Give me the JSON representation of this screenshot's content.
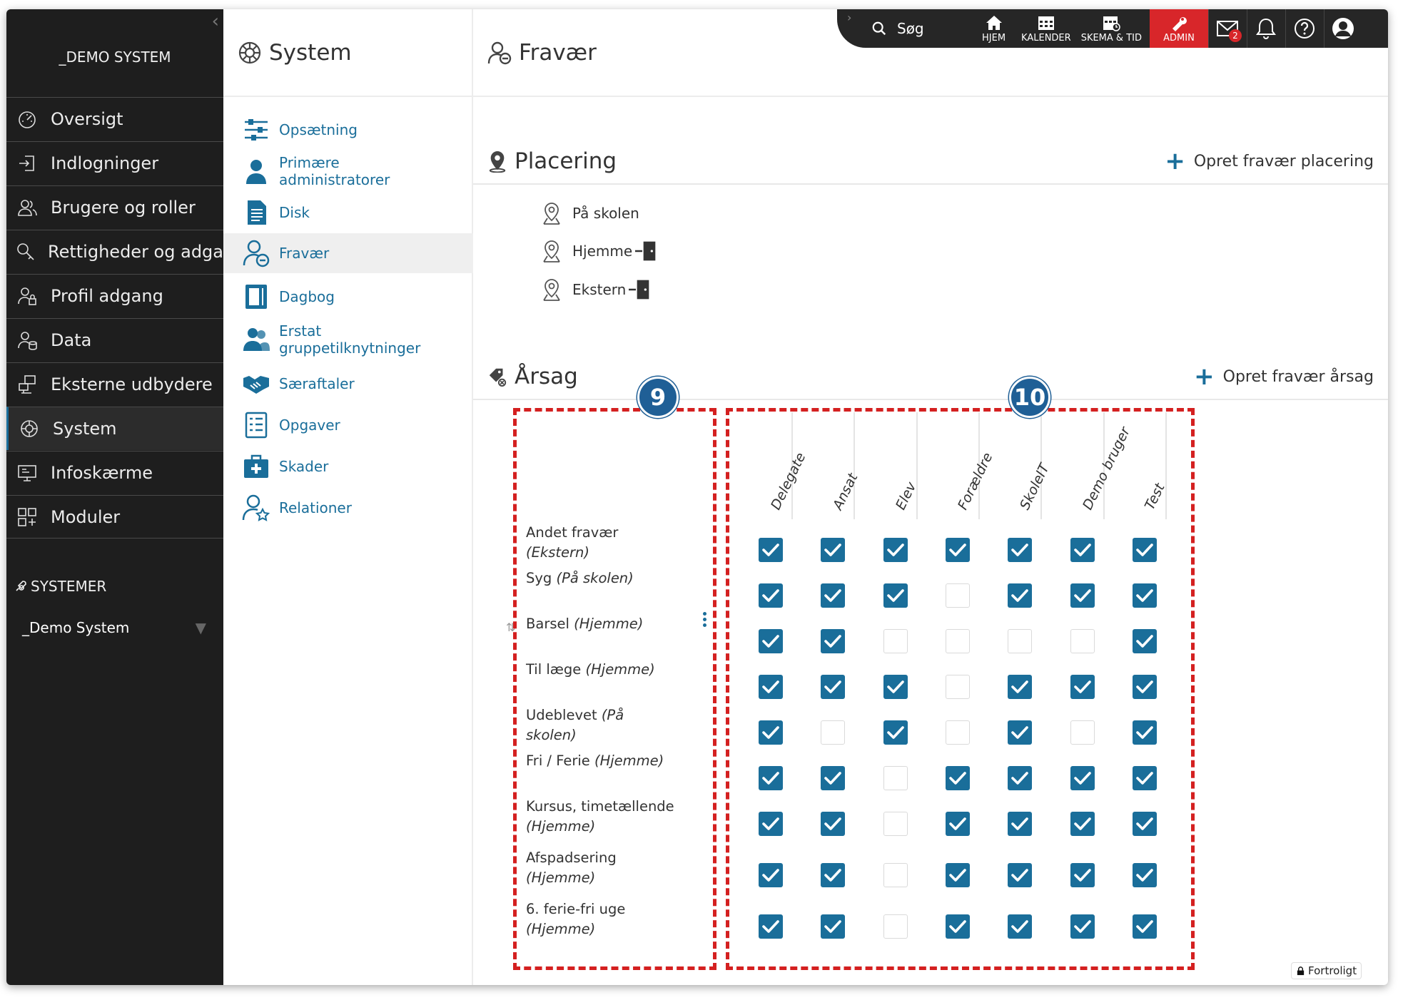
{
  "sidebar": {
    "brand": "_DEMO SYSTEM",
    "items": [
      {
        "label": "Oversigt",
        "icon": "gauge-icon"
      },
      {
        "label": "Indlogninger",
        "icon": "login-icon"
      },
      {
        "label": "Brugere og roller",
        "icon": "users-icon"
      },
      {
        "label": "Rettigheder og adgang",
        "icon": "key-search-icon"
      },
      {
        "label": "Profil adgang",
        "icon": "user-lock-icon"
      },
      {
        "label": "Data",
        "icon": "user-data-icon"
      },
      {
        "label": "Eksterne udbydere",
        "icon": "external-providers-icon"
      },
      {
        "label": "System",
        "icon": "globe-cog-icon"
      },
      {
        "label": "Infoskærme",
        "icon": "monitor-icon"
      },
      {
        "label": "Moduler",
        "icon": "modules-icon"
      }
    ],
    "systemer_label": "SYSTEMER",
    "system_select": "_Demo System"
  },
  "sysmenu": {
    "title": "System",
    "items": [
      {
        "label": "Opsætning"
      },
      {
        "label": "Primære administratorer"
      },
      {
        "label": "Disk"
      },
      {
        "label": "Fravær"
      },
      {
        "label": "Dagbog"
      },
      {
        "label": "Erstat gruppetilknytninger"
      },
      {
        "label": "Særaftaler"
      },
      {
        "label": "Opgaver"
      },
      {
        "label": "Skader"
      },
      {
        "label": "Relationer"
      }
    ]
  },
  "topbar": {
    "search": "Søg",
    "buttons": [
      {
        "label": "HJEM"
      },
      {
        "label": "KALENDER"
      },
      {
        "label": "SKEMA & TID"
      },
      {
        "label": "ADMIN"
      }
    ],
    "mail_badge": "2"
  },
  "main": {
    "title": "Fravær",
    "placering": {
      "title": "Placering",
      "action": "Opret fravær placering",
      "items": [
        "På skolen",
        "Hjemme",
        "Ekstern"
      ]
    },
    "arsag": {
      "title": "Årsag",
      "action": "Opret fravær årsag",
      "columns": [
        "Delegate",
        "Ansat",
        "Elev",
        "Forældre",
        "SkoleIT",
        "Demo bruger",
        "Test"
      ],
      "rows": [
        {
          "name": "Andet fravær",
          "place": "(Ekstern)",
          "checks": [
            1,
            1,
            1,
            1,
            1,
            1,
            1
          ]
        },
        {
          "name": "Syg",
          "place": "(På skolen)",
          "checks": [
            1,
            1,
            1,
            0,
            1,
            1,
            1
          ]
        },
        {
          "name": "Barsel",
          "place": "(Hjemme)",
          "checks": [
            1,
            1,
            0,
            0,
            0,
            0,
            1
          ]
        },
        {
          "name": "Til læge",
          "place": "(Hjemme)",
          "checks": [
            1,
            1,
            1,
            0,
            1,
            1,
            1
          ]
        },
        {
          "name": "Udeblevet",
          "place": "(På skolen)",
          "checks": [
            1,
            0,
            1,
            0,
            1,
            0,
            1
          ]
        },
        {
          "name": "Fri / Ferie",
          "place": "(Hjemme)",
          "checks": [
            1,
            1,
            0,
            1,
            1,
            1,
            1
          ]
        },
        {
          "name": "Kursus, timetællende",
          "place": "(Hjemme)",
          "checks": [
            1,
            1,
            0,
            1,
            1,
            1,
            1
          ]
        },
        {
          "name": "Afspadsering",
          "place": "(Hjemme)",
          "checks": [
            1,
            1,
            0,
            1,
            1,
            1,
            1
          ]
        },
        {
          "name": "6. ferie-fri uge",
          "place": "(Hjemme)",
          "checks": [
            1,
            1,
            0,
            1,
            1,
            1,
            1
          ]
        }
      ]
    }
  },
  "callouts": [
    "9",
    "10"
  ],
  "confidential": "Fortroligt",
  "colors": {
    "accent": "#1a6e9a",
    "admin": "#d8262a",
    "sidebar": "#1e1e1e",
    "annotation": "#d42020",
    "callout": "#1f5f96"
  }
}
